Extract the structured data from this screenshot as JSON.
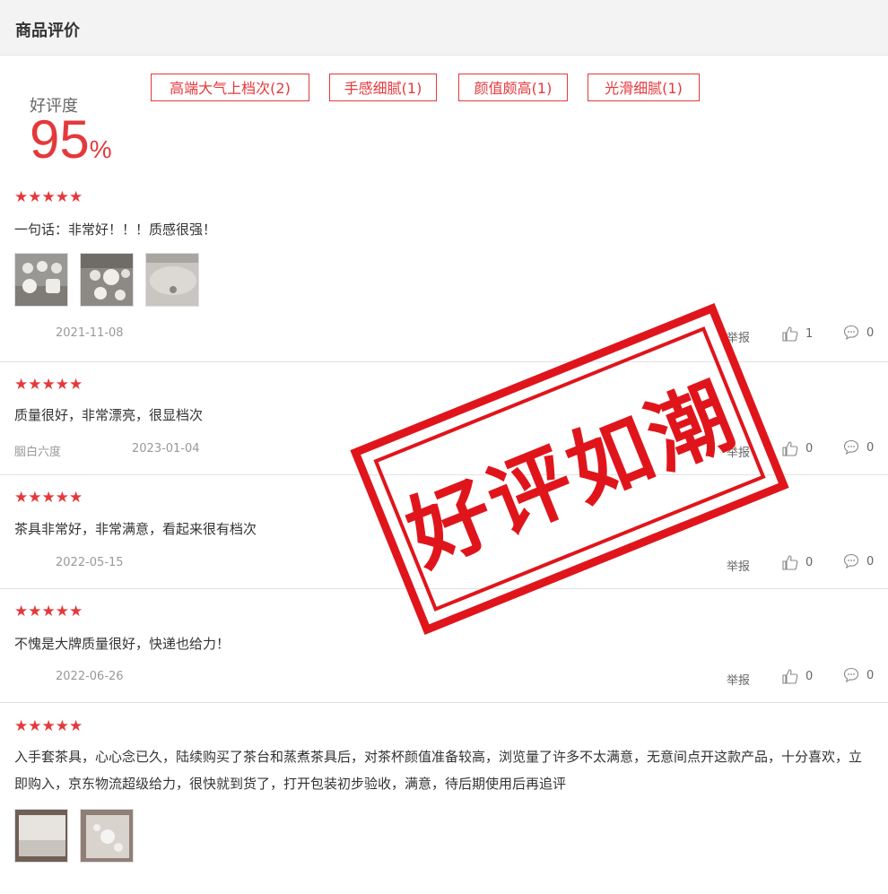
{
  "header": {
    "title": "商品评价"
  },
  "summary": {
    "label": "好评度",
    "value": "95",
    "unit": "%"
  },
  "tags": [
    "高端大气上档次(2)",
    "手感细腻(1)",
    "颜值颇高(1)",
    "光滑细腻(1)"
  ],
  "stars_text": "★★★★★",
  "report_label": "举报",
  "stamp_text": "好评如潮",
  "reviews": [
    {
      "rating": 5,
      "content": "一句话：非常好！！！质感很强！",
      "user": "",
      "date": "2021-11-08",
      "likes": "1",
      "comments": "0"
    },
    {
      "rating": 5,
      "content": "质量很好，非常漂亮，很显档次",
      "user": "胭白六度",
      "date": "2023-01-04",
      "likes": "0",
      "comments": "0"
    },
    {
      "rating": 5,
      "content": "茶具非常好，非常满意，看起来很有档次",
      "user": "",
      "date": "2022-05-15",
      "likes": "0",
      "comments": "0"
    },
    {
      "rating": 5,
      "content": "不愧是大牌质量很好，快递也给力！",
      "user": "",
      "date": "2022-06-26",
      "likes": "0",
      "comments": "0"
    },
    {
      "rating": 5,
      "content": "入手套茶具，心心念已久，陆续购买了茶台和蒸煮茶具后，对茶杯颜值准备较高，浏览量了许多不太满意，无意间点开这款产品，十分喜欢，立即购入，京东物流超级给力，很快就到货了，打开包装初步验收，满意，待后期使用后再追评",
      "user": "",
      "date": "",
      "likes": "",
      "comments": ""
    }
  ],
  "colors": {
    "accent": "#e4393c",
    "header_bg": "#f3f3f3",
    "muted": "#999999"
  }
}
